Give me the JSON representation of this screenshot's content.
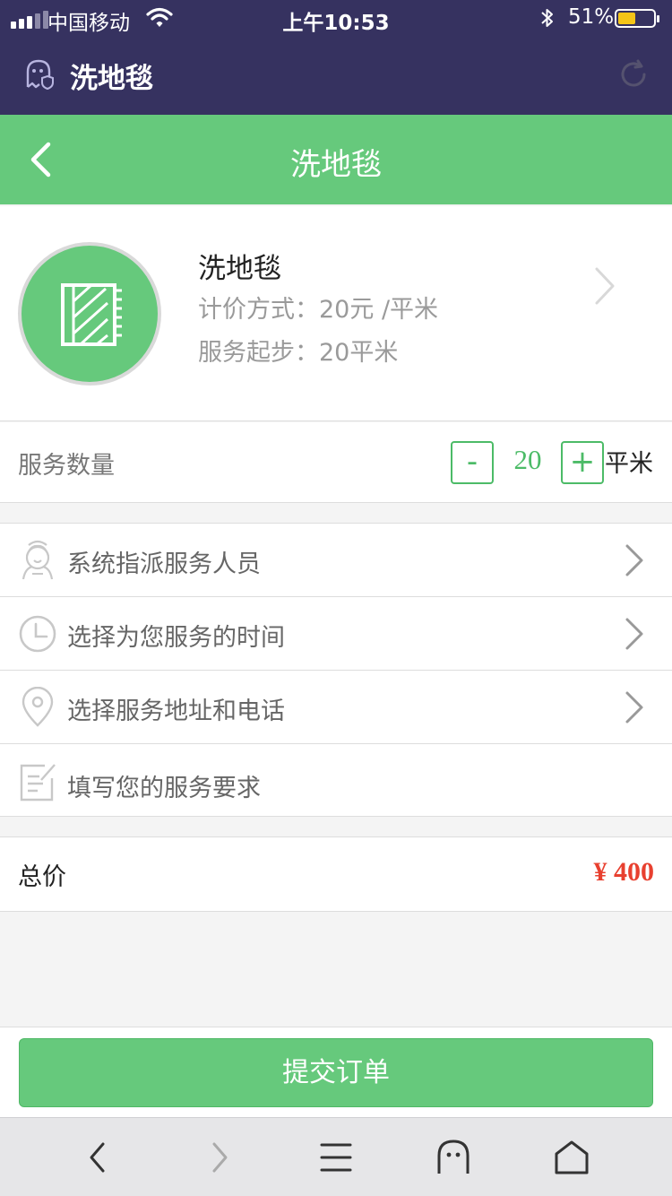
{
  "status_bar": {
    "carrier": "中国移动",
    "time": "上午10:53",
    "battery_percent": "51%",
    "battery_level": 0.51,
    "icons": [
      "signal-icon",
      "wifi-icon",
      "bluetooth-icon",
      "battery-icon"
    ]
  },
  "app_bar": {
    "title": "洗地毯",
    "icons": [
      "ghost-shield-icon",
      "refresh-icon"
    ]
  },
  "nav": {
    "title": "洗地毯",
    "icons": [
      "back-chevron-icon"
    ]
  },
  "product": {
    "name": "洗地毯",
    "price_text": "计价方式：20元 /平米",
    "minimum_text": "服务起步：20平米",
    "icons": [
      "carpet-icon",
      "chevron-right-icon"
    ]
  },
  "quantity": {
    "label": "服务数量",
    "minus": "-",
    "plus": "+",
    "value": "20",
    "unit": "平米"
  },
  "options": [
    {
      "label": "系统指派服务人员",
      "icon": "worker-icon",
      "has_chevron": true
    },
    {
      "label": "选择为您服务的时间",
      "icon": "clock-icon",
      "has_chevron": true
    },
    {
      "label": "选择服务地址和电话",
      "icon": "location-pin-icon",
      "has_chevron": true
    },
    {
      "label": "填写您的服务要求",
      "icon": "edit-note-icon",
      "has_chevron": false
    }
  ],
  "total": {
    "label": "总价",
    "value": "¥ 400"
  },
  "submit": {
    "label": "提交订单"
  },
  "browser_toolbar": {
    "icons": [
      "back-icon",
      "forward-icon",
      "menu-icon",
      "ghost-icon",
      "home-icon"
    ]
  },
  "colors": {
    "header_dark": "#363260",
    "accent_green": "#66c97c",
    "price_red": "#e8402f"
  }
}
